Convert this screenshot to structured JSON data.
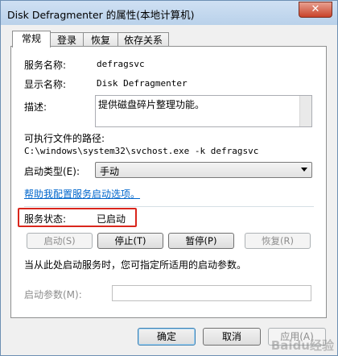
{
  "window": {
    "title": "Disk Defragmenter 的属性(本地计算机)",
    "close_glyph": "✕"
  },
  "tabs": [
    {
      "label": "常规",
      "active": true
    },
    {
      "label": "登录"
    },
    {
      "label": "恢复"
    },
    {
      "label": "依存关系"
    }
  ],
  "general": {
    "service_name_label": "服务名称:",
    "service_name_value": "defragsvc",
    "display_name_label": "显示名称:",
    "display_name_value": "Disk Defragmenter",
    "description_label": "描述:",
    "description_value": "提供磁盘碎片整理功能。",
    "exe_path_label": "可执行文件的路径:",
    "exe_path_value": "C:\\windows\\system32\\svchost.exe -k defragsvc",
    "startup_type_label": "启动类型(E):",
    "startup_type_value": "手动",
    "help_link": "帮助我配置服务启动选项。",
    "service_status_label": "服务状态:",
    "service_status_value": "已启动",
    "buttons": {
      "start": "启动(S)",
      "stop": "停止(T)",
      "pause": "暂停(P)",
      "resume": "恢复(R)"
    },
    "hint_text": "当从此处启动服务时，您可指定所适用的启动参数。",
    "start_params_label": "启动参数(M):",
    "start_params_value": ""
  },
  "footer": {
    "ok": "确定",
    "cancel": "取消",
    "apply": "应用(A)"
  },
  "watermark": "Baidu经验",
  "colors": {
    "highlight_box": "#d9261c",
    "link": "#0066cc"
  }
}
